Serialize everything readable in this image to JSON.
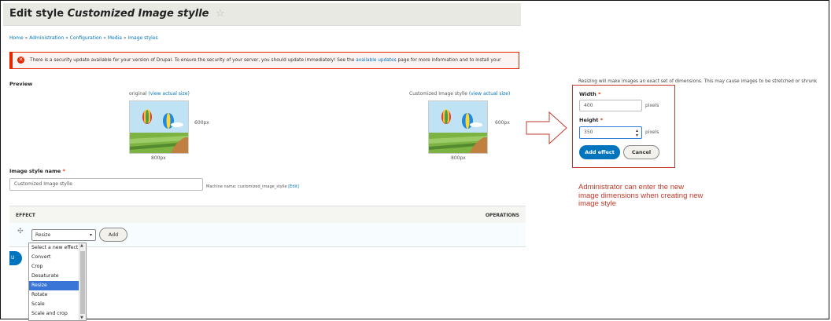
{
  "page": {
    "title_prefix": "Edit style",
    "title_name": "Customized Image stylle",
    "star": "☆",
    "breadcrumb": [
      "Home",
      "Administration",
      "Configuration",
      "Media",
      "Image styles"
    ],
    "breadcrumb_sep": "»"
  },
  "alert": {
    "text_before": "There is a security update available for your version of Drupal. To ensure the security of your server, you should update immediately! See the",
    "link": "available updates",
    "text_after": "page for more information and to install your"
  },
  "preview": {
    "label": "Preview",
    "original_caption": "original",
    "styled_caption": "Customized Image stylle",
    "view_link": "(view actual size)",
    "height_label": "600px",
    "width_label": "800px"
  },
  "image_style_name": {
    "label": "Image style name",
    "required": "*",
    "value": "Customized Image stylle",
    "machine_name_label": "Machine name: customized_image_stylle",
    "edit_link": "[Edit]"
  },
  "effects_table": {
    "col_effect": "EFFECT",
    "col_operations": "OPERATIONS",
    "drag_glyph": "✣",
    "selected_effect": "Resize",
    "add_button": "Add",
    "partial_button": "U",
    "options": [
      "Select a new effect",
      "Convert",
      "Crop",
      "Desaturate",
      "Resize",
      "Rotate",
      "Scale",
      "Scale and crop"
    ],
    "selected_index": 4
  },
  "resize_form": {
    "note": "Resizing will make images an exact set of dimensions. This may cause images to be stretched or shrunk",
    "width_label": "Width",
    "width_value": "400",
    "height_label": "Height",
    "height_value": "350",
    "required": "*",
    "unit": "pixels",
    "add_effect_button": "Add effect",
    "cancel_button": "Cancel"
  },
  "annotation": {
    "line1": "Administrator can enter the new",
    "line2": "image dimensions when creating new",
    "line3": "image style"
  },
  "colors": {
    "accent_blue": "#0074bd",
    "error_red": "#e62600",
    "annotation_red": "#c0392b",
    "selected_option": "#3875d7"
  }
}
